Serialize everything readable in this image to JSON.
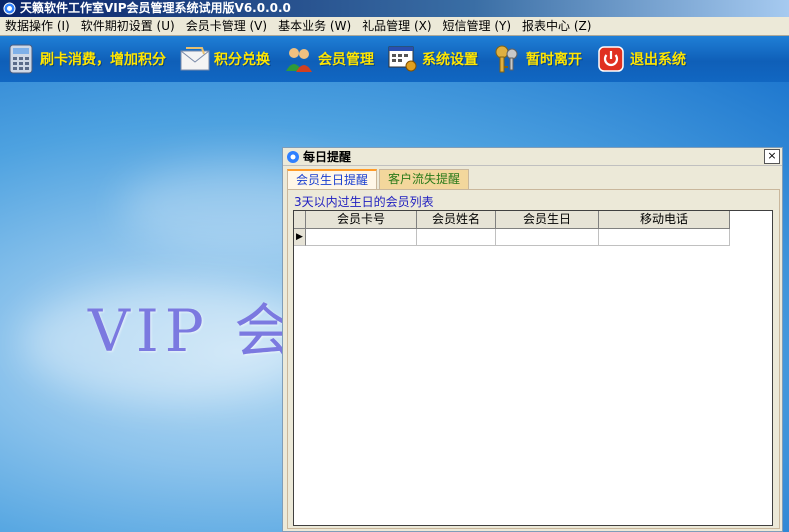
{
  "window": {
    "title": "天籁软件工作室VIP会员管理系统试用版V6.0.0.0"
  },
  "menu": [
    {
      "label": "数据操作 (I)"
    },
    {
      "label": "软件期初设置 (U)"
    },
    {
      "label": "会员卡管理 (V)"
    },
    {
      "label": "基本业务 (W)"
    },
    {
      "label": "礼品管理 (X)"
    },
    {
      "label": "短信管理 (Y)"
    },
    {
      "label": "报表中心 (Z)"
    }
  ],
  "toolbar": {
    "swipe_label": "刷卡消费，增加积分",
    "exchange_label": "积分兑换",
    "member_label": "会员管理",
    "settings_label": "系统设置",
    "leave_label": "暂时离开",
    "exit_label": "退出系统",
    "label_color": "#ffe600"
  },
  "desktop": {
    "watermark": "VIP 会"
  },
  "dialog": {
    "title": "每日提醒",
    "close_label": "×",
    "tabs": [
      {
        "label": "会员生日提醒",
        "active": true
      },
      {
        "label": "客户流失提醒",
        "active": false
      }
    ],
    "group_label": "3天以内过生日的会员列表",
    "columns": [
      "会员卡号",
      "会员姓名",
      "会员生日",
      "移动电话"
    ],
    "row_indicator": "▶"
  }
}
